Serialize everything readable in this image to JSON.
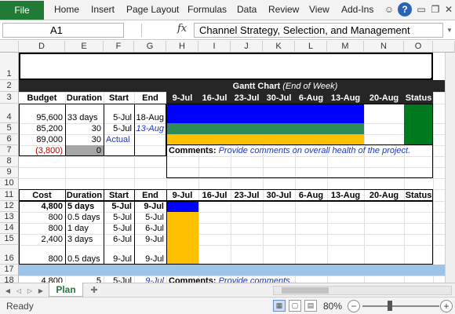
{
  "ribbon": {
    "file": "File",
    "tabs": [
      "Home",
      "Insert",
      "Page Layout",
      "Formulas",
      "Data",
      "Review",
      "View",
      "Add-Ins"
    ],
    "icons": [
      "smiley-icon",
      "help-icon",
      "minimize-icon",
      "restore-icon",
      "close-icon"
    ]
  },
  "formula_bar": {
    "name_box": "A1",
    "fx": "fx",
    "content": "Channel Strategy, Selection, and Management"
  },
  "columns": [
    "D",
    "E",
    "F",
    "G",
    "H",
    "I",
    "J",
    "K",
    "L",
    "M",
    "N",
    "O"
  ],
  "rows": [
    "1",
    "2",
    "3",
    "4",
    "5",
    "6",
    "7",
    "8",
    "9",
    "10",
    "11",
    "12",
    "13",
    "14",
    "15",
    "16",
    "17",
    "18"
  ],
  "gantt": {
    "title": "Gantt Chart",
    "title_note": "(End of Week)"
  },
  "header1": {
    "budget": "Budget",
    "duration": "Duration",
    "start": "Start",
    "end": "End",
    "weeks": [
      "9-Jul",
      "16-Jul",
      "23-Jul",
      "30-Jul",
      "6-Aug",
      "13-Aug",
      "20-Aug"
    ],
    "status": "Status"
  },
  "top_rows": [
    {
      "budget": "95,600",
      "duration": "33 days",
      "start": "5-Jul",
      "end": "18-Aug"
    },
    {
      "budget": "85,200",
      "duration": "30",
      "start": "5-Jul",
      "end": "13-Aug"
    },
    {
      "budget": "89,000",
      "duration": "30",
      "start": "Actual",
      "end": ""
    },
    {
      "budget": "(3,800)",
      "duration": "0",
      "start": "",
      "end": ""
    }
  ],
  "comments_label": "Comments:",
  "comments_text": "Provide comments on overall health of the project.",
  "header2": {
    "cost": "Cost",
    "duration": "Duration",
    "start": "Start",
    "end": "End",
    "weeks": [
      "9-Jul",
      "16-Jul",
      "23-Jul",
      "30-Jul",
      "6-Aug",
      "13-Aug",
      "20-Aug"
    ],
    "status": "Status"
  },
  "bottom_rows": [
    {
      "cost": "4,800",
      "duration": "5 days",
      "start": "5-Jul",
      "end": "9-Jul"
    },
    {
      "cost": "800",
      "duration": "0.5 days",
      "start": "5-Jul",
      "end": "5-Jul"
    },
    {
      "cost": "800",
      "duration": "1 day",
      "start": "5-Jul",
      "end": "6-Jul"
    },
    {
      "cost": "2,400",
      "duration": "3 days",
      "start": "6-Jul",
      "end": "9-Jul"
    },
    {
      "cost": "800",
      "duration": "0.5 days",
      "start": "9-Jul",
      "end": "9-Jul"
    }
  ],
  "row18": {
    "cost": "4,800",
    "duration": "5",
    "start": "5-Jul",
    "end": "9-Jul",
    "comments_label": "Comments:",
    "comments_text": "Provide comments..."
  },
  "sheet_tabs": [
    "Plan"
  ],
  "status": {
    "ready": "Ready",
    "zoom": "80%"
  },
  "colors": {
    "excel_green": "#217a36",
    "gantt_blue": "#0000ff",
    "gantt_green": "#2e8b57",
    "gantt_gold": "#ffc000",
    "status_green": "#007a1e",
    "header_dark": "#262626",
    "band_blue": "#9dc3e6",
    "col_highlight": "#fbf27a"
  }
}
